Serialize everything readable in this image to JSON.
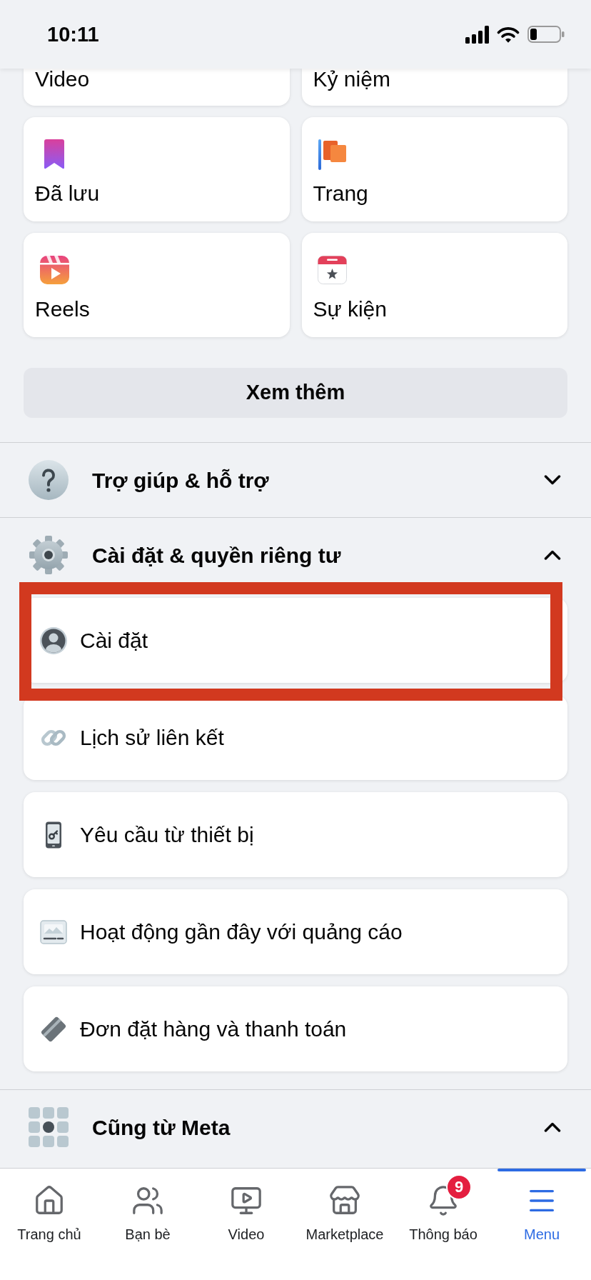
{
  "status_bar": {
    "time": "10:11"
  },
  "shortcuts": [
    {
      "label": "Video"
    },
    {
      "label": "Kỷ niệm"
    },
    {
      "label": "Đã lưu"
    },
    {
      "label": "Trang"
    },
    {
      "label": "Reels"
    },
    {
      "label": "Sự kiện"
    }
  ],
  "see_more_button": {
    "label": "Xem thêm"
  },
  "sections": [
    {
      "title": "Trợ giúp & hỗ trợ",
      "expanded": false
    },
    {
      "title": "Cài đặt & quyền riêng tư",
      "expanded": true,
      "items": [
        {
          "label": "Cài đặt",
          "highlighted": true
        },
        {
          "label": "Lịch sử liên kết",
          "highlighted": false
        },
        {
          "label": "Yêu cầu từ thiết bị",
          "highlighted": false
        },
        {
          "label": "Hoạt động gần đây với quảng cáo",
          "highlighted": false
        },
        {
          "label": "Đơn đặt hàng và thanh toán",
          "highlighted": false
        }
      ]
    },
    {
      "title": "Cũng từ Meta",
      "expanded": true
    }
  ],
  "tab_bar": [
    {
      "label": "Trang chủ",
      "selected": false
    },
    {
      "label": "Bạn bè",
      "selected": false
    },
    {
      "label": "Video",
      "selected": false
    },
    {
      "label": "Marketplace",
      "selected": false
    },
    {
      "label": "Thông báo",
      "selected": false,
      "badge": "9"
    },
    {
      "label": "Menu",
      "selected": true
    }
  ]
}
